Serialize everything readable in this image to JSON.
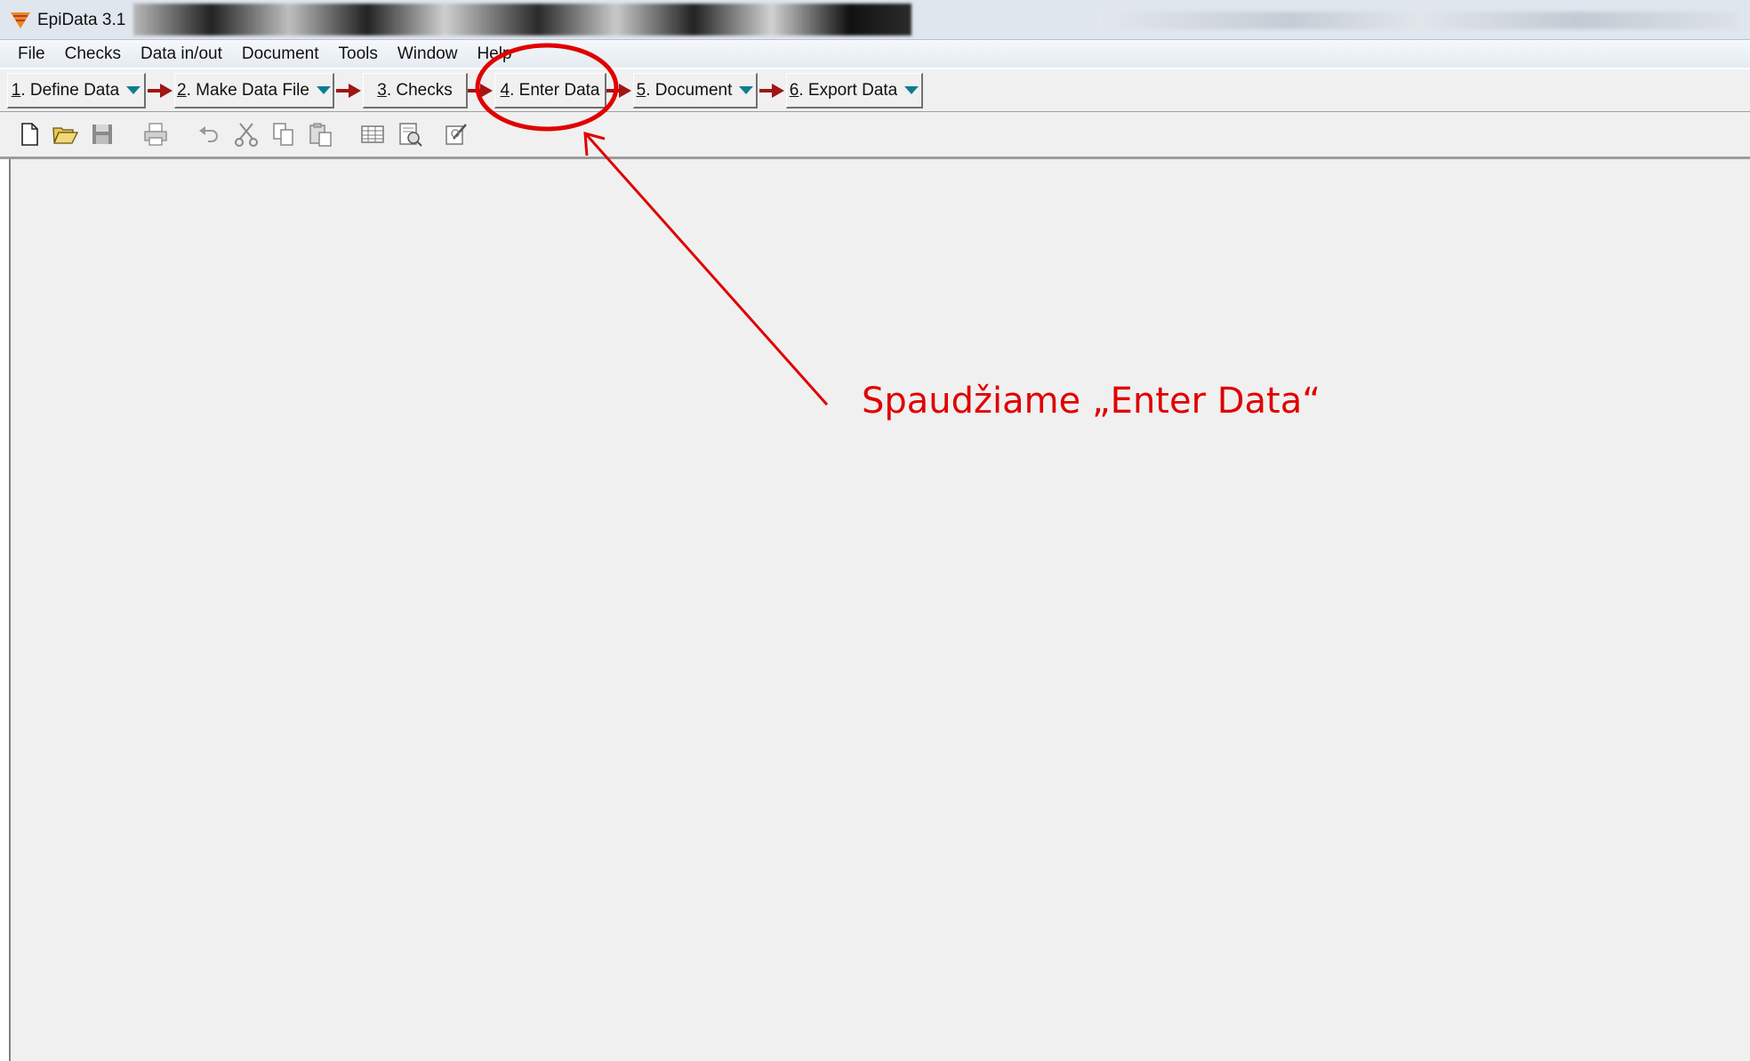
{
  "window": {
    "title": "EpiData 3.1"
  },
  "menu": [
    "File",
    "Checks",
    "Data in/out",
    "Document",
    "Tools",
    "Window",
    "Help"
  ],
  "workflow": [
    {
      "num": "1",
      "label": ". Define Data"
    },
    {
      "num": "2",
      "label": ". Make Data File"
    },
    {
      "num": "3",
      "label": ". Checks"
    },
    {
      "num": "4",
      "label": ". Enter Data"
    },
    {
      "num": "5",
      "label": ". Document"
    },
    {
      "num": "6",
      "label": ". Export Data"
    }
  ],
  "toolbar_icons": [
    "new-file-icon",
    "open-folder-icon",
    "save-icon",
    "print-icon",
    "undo-icon",
    "cut-icon",
    "copy-icon",
    "paste-icon",
    "table-icon",
    "preview-icon",
    "edit-icon"
  ],
  "annotation": {
    "text": "Spaudžiame „Enter Data“",
    "color": "#e00000"
  },
  "colors": {
    "accent_arrow": "#a01515",
    "dropdown": "#0f7d8f",
    "workspace": "#f0f0f0"
  }
}
